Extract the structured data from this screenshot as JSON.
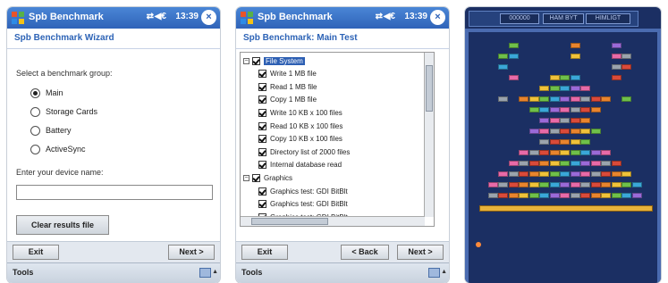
{
  "screen1": {
    "app_title": "Spb Benchmark",
    "signal": "⇄",
    "volume": "◀€",
    "time": "13:39",
    "close_label": "×",
    "header": "Spb Benchmark Wizard",
    "group_label": "Select a benchmark group:",
    "options": [
      {
        "label": "Main",
        "selected": true
      },
      {
        "label": "Storage Cards",
        "selected": false
      },
      {
        "label": "Battery",
        "selected": false
      },
      {
        "label": "ActiveSync",
        "selected": false
      }
    ],
    "device_name_label": "Enter your device name:",
    "device_name_value": "",
    "clear_button": "Clear results file",
    "exit_button": "Exit",
    "next_button": "Next >",
    "menu_tools": "Tools"
  },
  "screen2": {
    "app_title": "Spb Benchmark",
    "signal": "⇄",
    "volume": "◀€",
    "time": "13:39",
    "close_label": "×",
    "header": "Spb Benchmark: Main Test",
    "tree": [
      {
        "label": "File System",
        "level": 0,
        "selected": true
      },
      {
        "label": "Write 1 MB file",
        "level": 1
      },
      {
        "label": "Read 1 MB file",
        "level": 1
      },
      {
        "label": "Copy 1 MB file",
        "level": 1
      },
      {
        "label": "Write 10 KB x 100 files",
        "level": 1
      },
      {
        "label": "Read 10 KB x 100 files",
        "level": 1
      },
      {
        "label": "Copy 10 KB x 100 files",
        "level": 1
      },
      {
        "label": "Directory list of 2000 files",
        "level": 1
      },
      {
        "label": "Internal database read",
        "level": 1
      },
      {
        "label": "Graphics",
        "level": 0
      },
      {
        "label": "Graphics test: GDI BitBlt",
        "level": 1
      },
      {
        "label": "Graphics test: GDI BitBlt",
        "level": 1
      },
      {
        "label": "Graphics test: GDI BitBlt",
        "level": 1
      }
    ],
    "exit_button": "Exit",
    "back_button": "< Back",
    "next_button": "Next >",
    "menu_tools": "Tools"
  },
  "game": {
    "hud": [
      "000000",
      "HAM BYT",
      "HIMLIGT"
    ],
    "colors": {
      "background": "#1b2f63",
      "wall": "#4a6bb0",
      "paddle": "#e7b23a",
      "ball": "#ff8a3a"
    }
  }
}
